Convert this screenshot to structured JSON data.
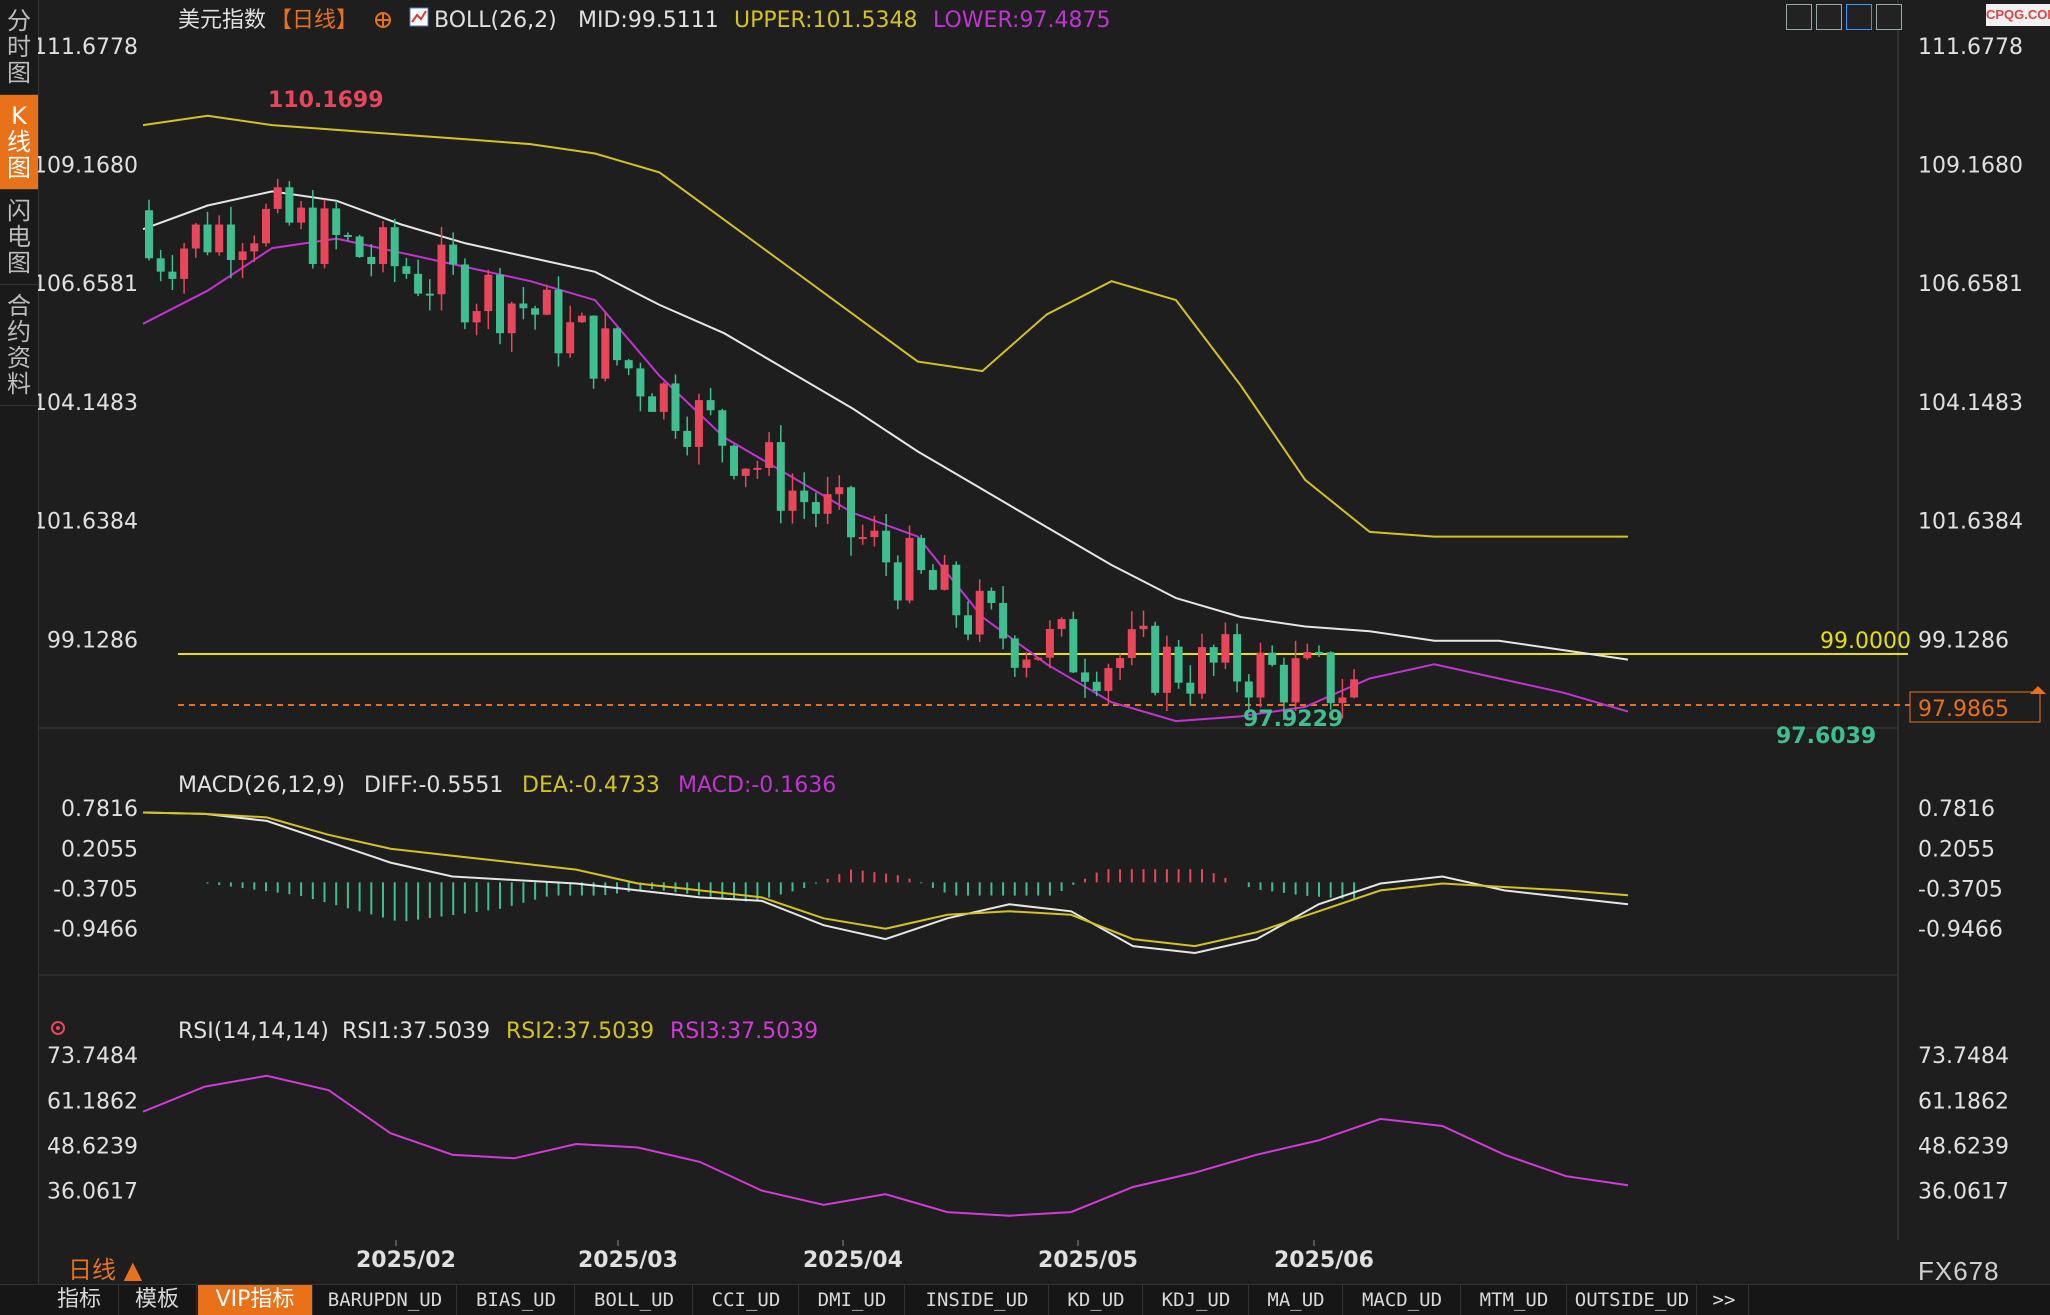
{
  "sidebar": {
    "tabs": [
      {
        "label": "分时图",
        "active": false
      },
      {
        "label": "K线图",
        "active": true
      },
      {
        "label": "闪电图",
        "active": false
      },
      {
        "label": "合约资料",
        "active": false
      }
    ]
  },
  "header": {
    "instrument": "美元指数",
    "period": "【日线】",
    "boll": "BOLL(26,2)",
    "mid": "MID:99.5111",
    "upper": "UPPER:101.5348",
    "lower": "LOWER:97.4875"
  },
  "logo": "CPQG.COM",
  "price_axis": {
    "ticks": [
      "111.6778",
      "109.1680",
      "106.6581",
      "104.1483",
      "101.6384",
      "99.1286"
    ]
  },
  "annotations": {
    "high": "110.1699",
    "low1": "97.9229",
    "low2": "97.6039",
    "hline": "99.0000",
    "last": "97.9865"
  },
  "macd": {
    "title": "MACD(26,12,9)",
    "diff": "DIFF:-0.5551",
    "dea": "DEA:-0.4733",
    "macd": "MACD:-0.1636",
    "ticks": [
      "0.7816",
      "0.2055",
      "-0.3705",
      "-0.9466"
    ]
  },
  "rsi": {
    "title": "RSI(14,14,14)",
    "rsi1": "RSI1:37.5039",
    "rsi2": "RSI2:37.5039",
    "rsi3": "RSI3:37.5039",
    "ticks": [
      "73.7484",
      "61.1862",
      "48.6239",
      "36.0617"
    ]
  },
  "time_axis": [
    "2025/02",
    "2025/03",
    "2025/04",
    "2025/05",
    "2025/06"
  ],
  "period_label": "日线 ▲",
  "watermark": "FX678",
  "bottom_bar": [
    "指标",
    "模板",
    "VIP指标",
    "BARUPDN_UD",
    "BIAS_UD",
    "BOLL_UD",
    "CCI_UD",
    "DMI_UD",
    "INSIDE_UD",
    "KD_UD",
    "KDJ_UD",
    "MA_UD",
    "MACD_UD",
    "MTM_UD",
    "OUTSIDE_UD",
    ">>"
  ],
  "colors": {
    "up": "#e8465a",
    "down": "#3fbf8f",
    "mid": "#e6e6e6",
    "upper": "#d4c21e",
    "lower": "#c233d4",
    "hline": "#e8e000",
    "diff": "#e6e6e6",
    "dea": "#d4c21e",
    "accent": "#e8711a",
    "rsi": "#d33ad8"
  },
  "chart_data": [
    {
      "type": "candlestick",
      "title": "美元指数 日线",
      "ylim": [
        97.0,
        111.8
      ],
      "x": [
        "2025/02",
        "2025/03",
        "2025/04",
        "2025/05",
        "2025/06"
      ],
      "series": [
        {
          "name": "BOLL MID",
          "values": [
            107.8,
            108.3,
            108.6,
            108.4,
            107.9,
            107.5,
            107.2,
            106.9,
            106.2,
            105.6,
            104.8,
            104.0,
            103.1,
            102.3,
            101.5,
            100.7,
            100.0,
            99.6,
            99.4,
            99.3,
            99.1,
            99.1,
            98.9,
            98.7
          ]
        },
        {
          "name": "BOLL UPPER",
          "values": [
            110.0,
            110.2,
            110.0,
            109.9,
            109.8,
            109.7,
            109.6,
            109.4,
            109.0,
            108.0,
            107.0,
            106.0,
            105.0,
            104.8,
            106.0,
            106.7,
            106.3,
            104.5,
            102.5,
            101.4,
            101.3,
            101.3,
            101.3,
            101.3
          ]
        },
        {
          "name": "BOLL LOWER",
          "values": [
            105.8,
            106.5,
            107.4,
            107.6,
            107.3,
            107.0,
            106.7,
            106.3,
            104.7,
            103.4,
            102.6,
            101.8,
            101.3,
            99.6,
            98.6,
            97.8,
            97.4,
            97.5,
            97.7,
            98.3,
            98.6,
            98.3,
            98.0,
            97.6
          ]
        }
      ],
      "high": 110.1699,
      "lows": [
        97.9229,
        97.6039
      ],
      "reference_line": 99.0,
      "last": 97.9865
    },
    {
      "type": "line",
      "title": "MACD(26,12,9)",
      "series": [
        {
          "name": "DIFF",
          "last": -0.5551
        },
        {
          "name": "DEA",
          "last": -0.4733
        },
        {
          "name": "MACD",
          "last": -0.1636
        }
      ],
      "ylim": [
        -1.4,
        0.9
      ]
    },
    {
      "type": "line",
      "title": "RSI(14,14,14)",
      "series": [
        {
          "name": "RSI1",
          "values": [
            58,
            65,
            68,
            64,
            52,
            46,
            45,
            49,
            48,
            44,
            36,
            32,
            35,
            30,
            29,
            30,
            37,
            41,
            46,
            50,
            56,
            54,
            46,
            40,
            37.5
          ]
        }
      ],
      "ylim": [
        25,
        78
      ]
    }
  ]
}
